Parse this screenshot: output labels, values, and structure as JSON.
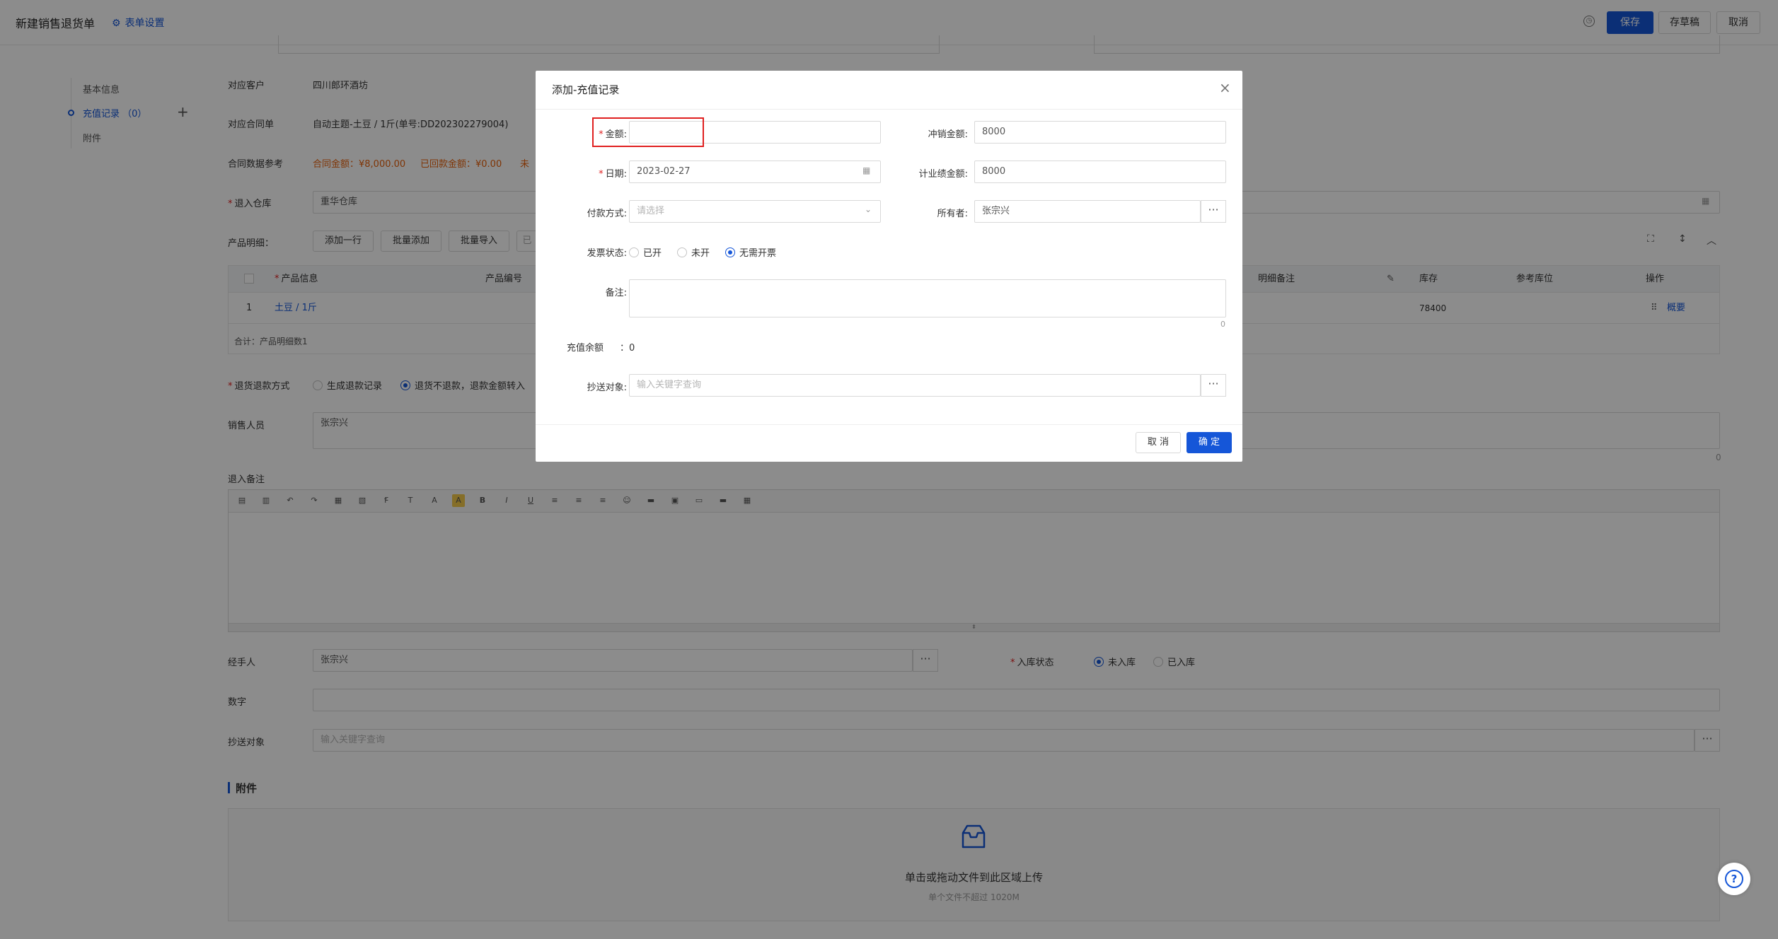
{
  "topbar": {
    "title": "新建销售退货单",
    "form_settings": "表单设置",
    "save": "保存",
    "draft": "存草稿",
    "cancel": "取消"
  },
  "nav": {
    "items": [
      {
        "label": "基本信息"
      },
      {
        "label": "充值记录 （0）"
      },
      {
        "label": "附件"
      }
    ]
  },
  "form": {
    "customer_label": "对应客户",
    "customer_value": "四川郎环酒坊",
    "contract_label": "对应合同单",
    "contract_value": "自动主题-土豆 / 1斤(单号:DD202302279004)",
    "contract_ref_label": "合同数据参考",
    "contract_amount": "合同金额：¥8,000.00",
    "returned_amount": "已回款金额：¥0.00",
    "returned_extra": "未",
    "warehouse_label": "退入仓库",
    "warehouse_value": "重华仓库",
    "products_label": "产品明细：",
    "add_row": "添加一行",
    "batch_add": "批量添加",
    "batch_import": "批量导入",
    "extra_btn": "已",
    "table": {
      "headers": [
        "产品信息",
        "产品编号",
        "明细备注",
        "库存",
        "参考库位",
        "操作"
      ],
      "row": {
        "index": "1",
        "product": "土豆 / 1斤",
        "stock": "78400",
        "action": "概要"
      },
      "footer": "合计：产品明细数1"
    },
    "refund_label": "退货退款方式",
    "refund_opt1": "生成退款记录",
    "refund_opt2": "退货不退款，退款金额转入",
    "sales_label": "销售人员",
    "sales_value": "张宗兴",
    "sales_count": "0",
    "remark_label": "退入备注",
    "handler_label": "经手人",
    "handler_value": "张宗兴",
    "instock_label": "入库状态",
    "instock_opt1": "未入库",
    "instock_opt2": "已入库",
    "number_label": "数字",
    "cc_label": "抄送对象",
    "cc_placeholder": "输入关键字查询",
    "attach_title": "附件",
    "upload_text": "单击或拖动文件到此区域上传",
    "upload_hint": "单个文件不超过 1020M"
  },
  "modal": {
    "title": "添加-充值记录",
    "amount_label": "金额:",
    "amount_value": "",
    "offset_label": "冲销金额:",
    "offset_value": "8000",
    "date_label": "日期:",
    "date_value": "2023-02-27",
    "perf_label": "计业绩金额:",
    "perf_value": "8000",
    "pay_label": "付款方式:",
    "pay_placeholder": "请选择",
    "owner_label": "所有者:",
    "owner_value": "张宗兴",
    "invoice_label": "发票状态:",
    "invoice_opts": [
      "已开",
      "未开",
      "无需开票"
    ],
    "remark_label": "备注:",
    "remark_count": "0",
    "balance_label": "充值余额",
    "balance_value": "：0",
    "cc_label": "抄送对象:",
    "cc_placeholder": "输入关键字查询",
    "cancel": "取 消",
    "confirm": "确 定"
  },
  "colors": {
    "primary": "#1556d8",
    "highlight": "#e02020",
    "warning": "#e8620c"
  }
}
